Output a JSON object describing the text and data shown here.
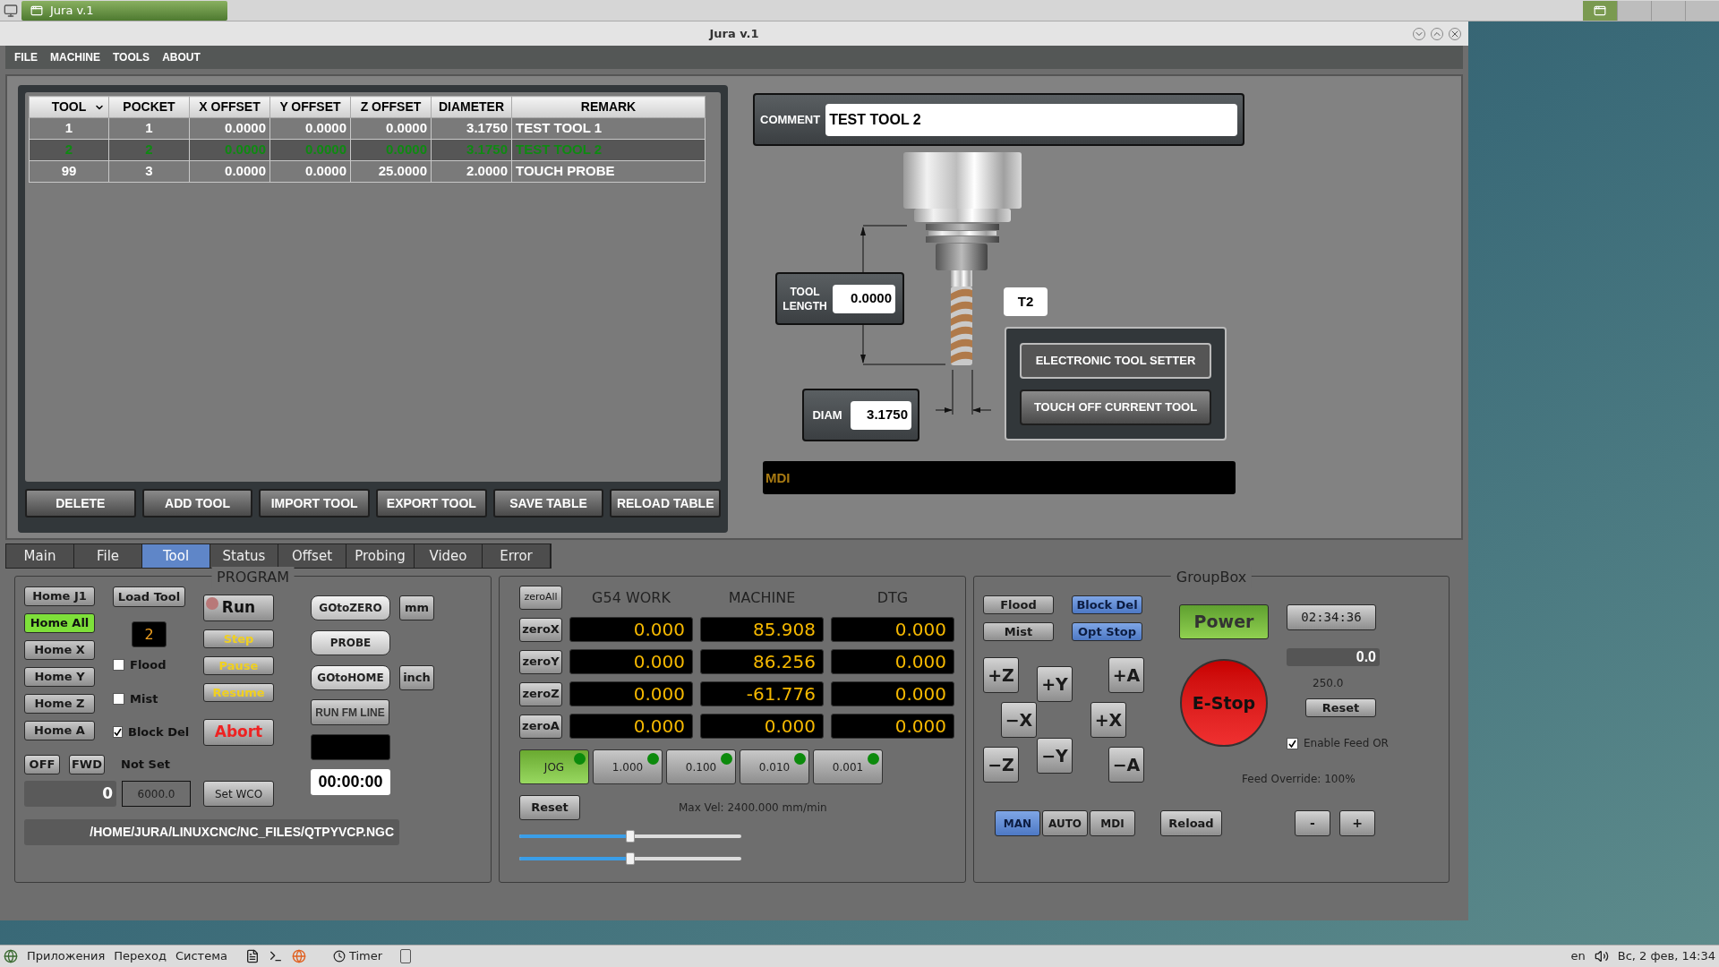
{
  "top_taskbar": {
    "window_button": "Jura v.1"
  },
  "window": {
    "title": "Jura v.1"
  },
  "menu": [
    "FILE",
    "MACHINE",
    "TOOLS",
    "ABOUT"
  ],
  "tool_table": {
    "columns": [
      "TOOL",
      "POCKET",
      "X OFFSET",
      "Y OFFSET",
      "Z OFFSET",
      "DIAMETER",
      "REMARK"
    ],
    "rows": [
      {
        "cells": [
          "1",
          "1",
          "0.0000",
          "0.0000",
          "0.0000",
          "3.1750",
          "TEST TOOL 1"
        ],
        "selected": false
      },
      {
        "cells": [
          "2",
          "2",
          "0.0000",
          "0.0000",
          "0.0000",
          "3.1750",
          "TEST TOOL 2"
        ],
        "selected": true
      },
      {
        "cells": [
          "99",
          "3",
          "0.0000",
          "0.0000",
          "25.0000",
          "2.0000",
          "TOUCH PROBE"
        ],
        "selected": false
      }
    ]
  },
  "table_buttons": [
    "DELETE",
    "ADD TOOL",
    "IMPORT TOOL",
    "EXPORT TOOL",
    "SAVE TABLE",
    "RELOAD TABLE"
  ],
  "comment": {
    "label": "COMMENT",
    "value": "TEST TOOL 2"
  },
  "tool_length": {
    "label": "TOOL LENGTH",
    "value": "0.0000"
  },
  "diameter": {
    "label": "DIAM",
    "value": "3.1750"
  },
  "tool_number": "T2",
  "setter_buttons": [
    "ELECTRONIC TOOL SETTER",
    "TOUCH OFF CURRENT TOOL"
  ],
  "mdi": {
    "placeholder": "MDI"
  },
  "tabs": [
    {
      "label": "Main",
      "selected": false
    },
    {
      "label": "File",
      "selected": false
    },
    {
      "label": "Tool",
      "selected": true
    },
    {
      "label": "Status",
      "selected": false
    },
    {
      "label": "Offset",
      "selected": false
    },
    {
      "label": "Probing",
      "selected": false
    },
    {
      "label": "Video",
      "selected": false
    },
    {
      "label": "Error",
      "selected": false
    }
  ],
  "program": {
    "title": "PROGRAM",
    "home_buttons": [
      {
        "label": "Home J1",
        "on": false
      },
      {
        "label": "Home All",
        "on": true
      },
      {
        "label": "Home X",
        "on": false
      },
      {
        "label": "Home Y",
        "on": false
      },
      {
        "label": "Home Z",
        "on": false
      },
      {
        "label": "Home A",
        "on": false
      }
    ],
    "load_tool": "Load Tool",
    "tool_display": "2",
    "checkboxes": [
      {
        "label": "Flood",
        "checked": false
      },
      {
        "label": "Mist",
        "checked": false
      },
      {
        "label": "Block Del",
        "checked": true
      }
    ],
    "run_buttons": [
      {
        "label": "Run",
        "kind": "run"
      },
      {
        "label": "Step",
        "kind": "step"
      },
      {
        "label": "Pause",
        "kind": "step"
      },
      {
        "label": "Resume",
        "kind": "step"
      },
      {
        "label": "Abort",
        "kind": "abort"
      }
    ],
    "spindle_buttons": [
      "OFF",
      "FWD"
    ],
    "spindle_status": "Not Set",
    "spindle_speed": "0",
    "speed_field": "6000.0",
    "set_wco": "Set WCO",
    "goto_buttons": [
      {
        "label": "GOtoZERO",
        "unit": "mm"
      },
      {
        "label": "PROBE"
      },
      {
        "label": "GOtoHOME",
        "unit": "inch"
      }
    ],
    "run_from_line": "RUN FM LINE",
    "timer": "00:00:00",
    "file_path": "/HOME/JURA/LINUXCNC/NC_FILES/QTPYVCP.NGC"
  },
  "dro": {
    "zero_all": "zeroAll",
    "columns": [
      "G54 WORK",
      "MACHINE",
      "DTG"
    ],
    "rows": [
      {
        "button": "zeroX",
        "values": [
          "0.000",
          "85.908",
          "0.000"
        ]
      },
      {
        "button": "zeroY",
        "values": [
          "0.000",
          "86.256",
          "0.000"
        ]
      },
      {
        "button": "zeroZ",
        "values": [
          "0.000",
          "-61.776",
          "0.000"
        ]
      },
      {
        "button": "zeroA",
        "values": [
          "0.000",
          "0.000",
          "0.000"
        ]
      }
    ],
    "jog": [
      {
        "label": "JOG",
        "selected": true
      },
      {
        "label": "1.000",
        "selected": false
      },
      {
        "label": "0.100",
        "selected": false
      },
      {
        "label": "0.010",
        "selected": false
      },
      {
        "label": "0.001",
        "selected": false
      }
    ],
    "reset": "Reset",
    "max_vel": "Max Vel: 2400.000 mm/min",
    "sliders": [
      {
        "level": 0.5
      },
      {
        "level": 0.5
      }
    ]
  },
  "groupbox": {
    "title": "GroupBox",
    "toggles": [
      {
        "label": "Flood",
        "on": false
      },
      {
        "label": "Block Del",
        "on": true
      },
      {
        "label": "Mist",
        "on": false
      },
      {
        "label": "Opt Stop",
        "on": true
      }
    ],
    "jog_buttons": [
      "+Z",
      "+Y",
      "+A",
      "−X",
      "+X",
      "−Z",
      "−Y",
      "−A"
    ],
    "power": "Power",
    "estop": "E-Stop",
    "clock": "02:34:36",
    "feed_display": "0.0",
    "feed_value": "250.0",
    "reset": "Reset",
    "enable_feed": {
      "label": "Enable Feed OR",
      "checked": true
    },
    "feed_override": "Feed Override: 100%",
    "modes": [
      {
        "label": "MAN",
        "selected": true
      },
      {
        "label": "AUTO",
        "selected": false
      },
      {
        "label": "MDI",
        "selected": false
      }
    ],
    "reload": "Reload",
    "minus": "-",
    "plus": "+"
  },
  "bottom_taskbar": {
    "menus": [
      "Приложения",
      "Переход",
      "Система"
    ],
    "timer": "Timer",
    "language": "en",
    "clock": "Вс, 2 фев, 14:34"
  }
}
